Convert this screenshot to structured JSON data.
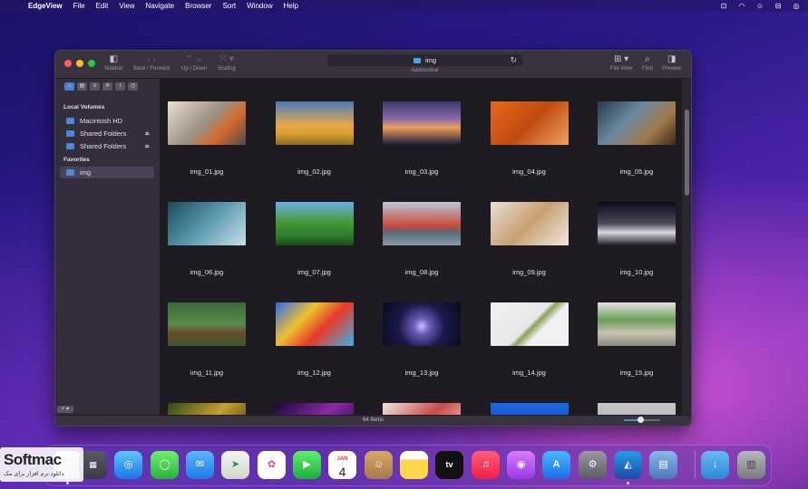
{
  "menubar": {
    "app": "EdgeView",
    "items": [
      "File",
      "Edit",
      "View",
      "Navigate",
      "Browser",
      "Sort",
      "Window",
      "Help"
    ]
  },
  "toolbar": {
    "sidebar_label": "Sidebar",
    "back_forward_label": "Back / Forward",
    "up_down_label": "Up / Down",
    "scaling_label": "Scaling",
    "addressbar_label": "Addressbar",
    "address_value": "img",
    "file_view_label": "File View",
    "find_label": "Find",
    "preview_label": "Preview"
  },
  "sidebar": {
    "local_volumes_heading": "Local Volumes",
    "volumes": [
      "Macintosh HD",
      "Shared Folders",
      "Shared Folders"
    ],
    "favorites_heading": "Favorites",
    "favorites": [
      "img"
    ]
  },
  "files": [
    "img_01.jpg",
    "img_02.jpg",
    "img_03.jpg",
    "img_04.jpg",
    "img_05.jpg",
    "img_06.jpg",
    "img_07.jpg",
    "img_08.jpg",
    "img_09.jpg",
    "img_10.jpg",
    "img_11.jpg",
    "img_12.jpg",
    "img_13.jpg",
    "img_14.jpg",
    "img_15.jpg",
    "",
    "",
    "",
    "",
    ""
  ],
  "statusbar": {
    "item_count": "64 Items",
    "zoom_level": 0.45
  },
  "dock": {
    "calendar_month": "JAN",
    "calendar_day": "4",
    "tv_label": "tv"
  },
  "watermark": {
    "logo": "Softmac",
    "tagline": "دانلود نرم افزار برای مک"
  },
  "colors": {
    "accent": "#4a89d8",
    "window_bg": "#2a2630",
    "sidebar_bg": "#332d3c",
    "content_bg": "#1e1b23"
  }
}
